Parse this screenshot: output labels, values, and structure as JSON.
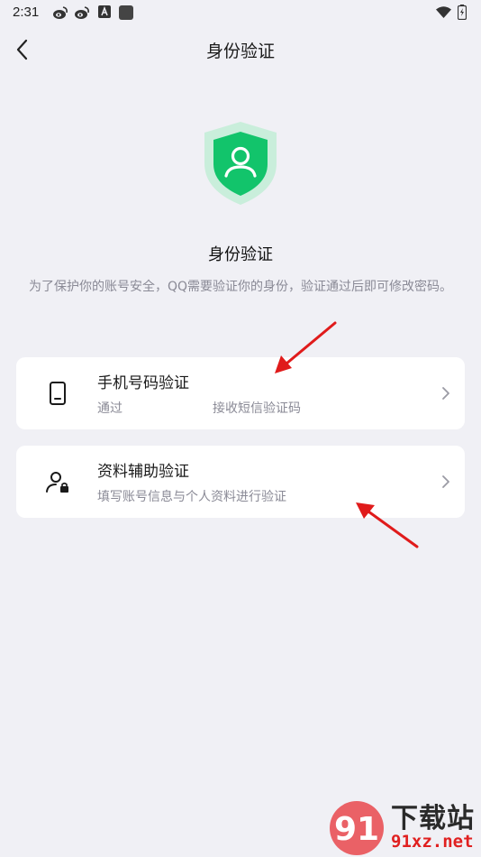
{
  "status_bar": {
    "time": "2:31",
    "icons": [
      "weibo-icon",
      "weibo-icon",
      "a-notification-icon",
      "app-notification-icon",
      "wifi-icon",
      "battery-charging-icon"
    ]
  },
  "nav": {
    "back_icon": "chevron-left-icon",
    "title": "身份验证"
  },
  "hero": {
    "icon": "shield-user-icon",
    "title": "身份验证",
    "description": "为了保护你的账号安全，QQ需要验证你的身份，验证通过后即可修改密码。"
  },
  "options": [
    {
      "icon": "phone-icon",
      "title": "手机号码验证",
      "subtitle_prefix": "通过",
      "subtitle_suffix": "接收短信验证码"
    },
    {
      "icon": "user-lock-icon",
      "title": "资料辅助验证",
      "subtitle": "填写账号信息与个人资料进行验证"
    }
  ],
  "watermark": {
    "logo_text": "91",
    "line1": "下载站",
    "line2": "91xz.net"
  },
  "colors": {
    "background": "#f0f0f5",
    "card": "#ffffff",
    "accent_green": "#12c46b",
    "shield_light": "#c9eedb",
    "annotation_red": "#e01b1b",
    "secondary_text": "#8a8a96"
  }
}
